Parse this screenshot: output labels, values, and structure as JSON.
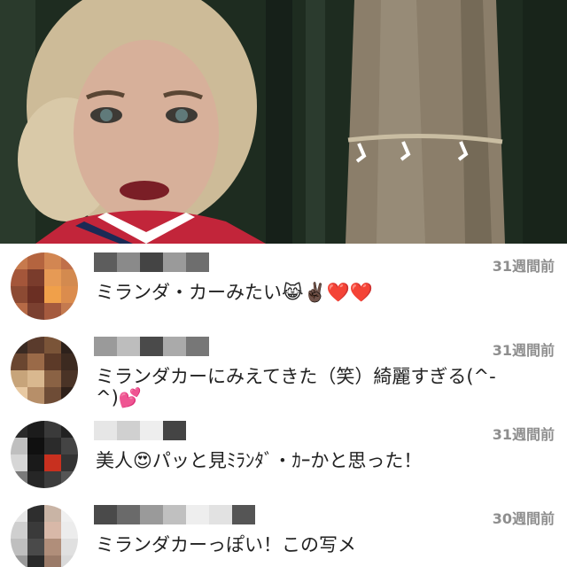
{
  "comments": [
    {
      "time": "31週間前",
      "text": "ミランダ・カーみたい😹✌🏿❤️❤️"
    },
    {
      "time": "31週間前",
      "text": "ミランダカーにみえてきた（笑）綺麗すぎる(^-",
      "text2": "^)💕"
    },
    {
      "time": "31週間前",
      "text": "美人😍パッと見ﾐﾗﾝﾀﾞ・ｶｰかと思った！"
    },
    {
      "time": "30週間前",
      "text": "ミランダカーっぽい！この写メ"
    }
  ],
  "colors": {
    "time": "#8e8e8e",
    "text": "#222222",
    "background": "#ffffff"
  },
  "icons": {
    "photo": "portrait-photo"
  }
}
